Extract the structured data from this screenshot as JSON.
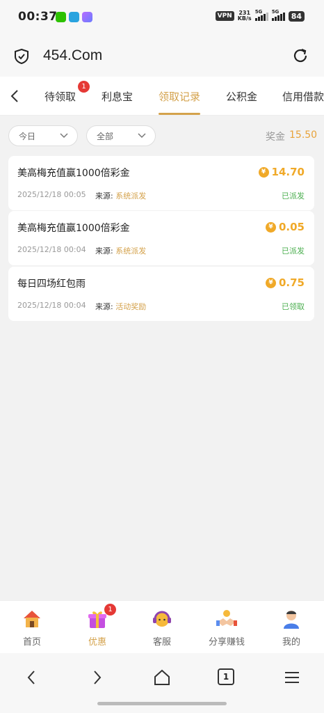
{
  "status_bar": {
    "time": "00:37",
    "vpn": "VPN",
    "speed_value": "231",
    "speed_unit": "KB/s",
    "sim1": "5G",
    "sim2": "5G",
    "battery": "84"
  },
  "browser": {
    "url": "454.Com"
  },
  "tabs": [
    {
      "label": "待领取",
      "badge": "1"
    },
    {
      "label": "利息宝"
    },
    {
      "label": "领取记录",
      "active": true
    },
    {
      "label": "公积金"
    },
    {
      "label": "信用借款"
    }
  ],
  "filters": {
    "date": "今日",
    "type": "全部"
  },
  "bonus": {
    "label": "奖金",
    "value": "15.50"
  },
  "source_label": "来源:",
  "records": [
    {
      "title": "美高梅充值赢1000倍彩金",
      "amount": "14.70",
      "date": "2025/12/18 00:05",
      "source": "系统派发",
      "status": "已派发"
    },
    {
      "title": "美高梅充值赢1000倍彩金",
      "amount": "0.05",
      "date": "2025/12/18 00:04",
      "source": "系统派发",
      "status": "已派发"
    },
    {
      "title": "每日四场红包雨",
      "amount": "0.75",
      "date": "2025/12/18 00:04",
      "source": "活动奖励",
      "status": "已领取"
    }
  ],
  "bottom_nav": [
    {
      "label": "首页"
    },
    {
      "label": "优惠",
      "badge": "1",
      "active": true
    },
    {
      "label": "客服"
    },
    {
      "label": "分享赚钱"
    },
    {
      "label": "我的"
    }
  ],
  "system_nav": {
    "tab_count": "1"
  },
  "colors": {
    "accent": "#d4a24c",
    "amount": "#f0a928",
    "status_green": "#4caf50",
    "badge_red": "#e53935"
  }
}
